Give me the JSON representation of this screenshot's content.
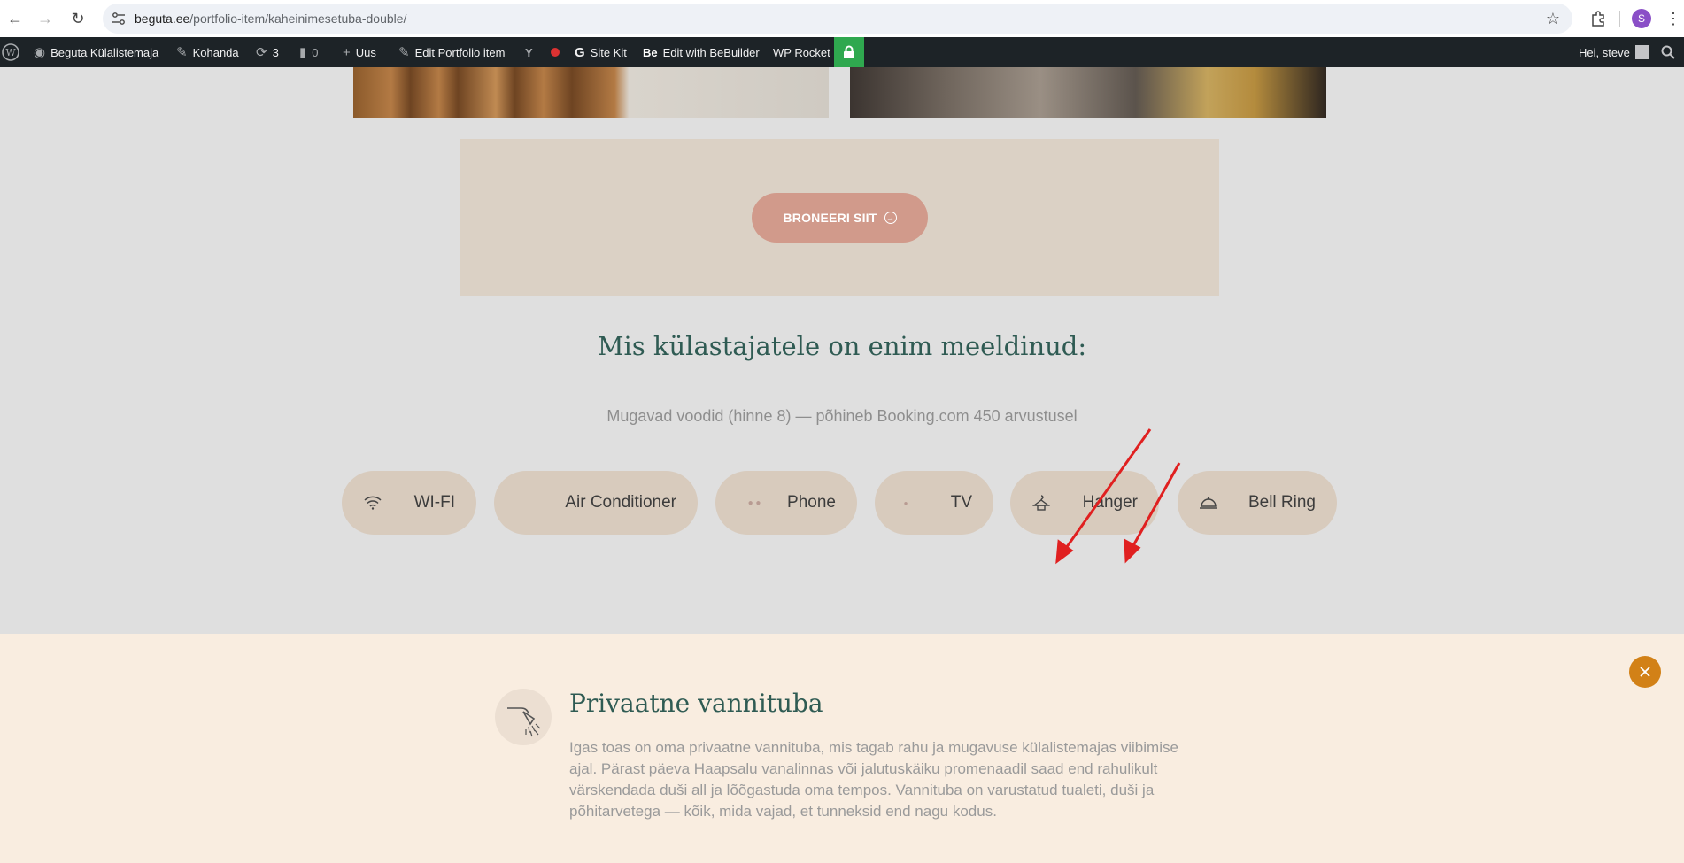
{
  "browser": {
    "url_host": "beguta.ee",
    "url_path": "/portfolio-item/kaheinimesetuba-double/",
    "profile_initial": "S"
  },
  "adminbar": {
    "site_name": "Beguta Külalistemaja",
    "customize": "Kohanda",
    "updates_count": "3",
    "comments_count": "0",
    "new": "Uus",
    "edit_item": "Edit Portfolio item",
    "site_kit": "Site Kit",
    "bebuilder": "Edit with BeBuilder",
    "wp_rocket": "WP Rocket",
    "greeting": "Hei, steve"
  },
  "booking": {
    "button_label": "BRONEERI SIIT"
  },
  "amenities": {
    "title": "Mis külastajatele on enim meeldinud:",
    "subtitle": "Mugavad voodid (hinne 8) — põhineb Booking.com 450 arvustusel",
    "items": [
      {
        "label": "WI-FI",
        "icon": "wifi-icon"
      },
      {
        "label": "Air Conditioner",
        "icon": "air-conditioner-icon"
      },
      {
        "label": "Phone",
        "icon": "phone-icon"
      },
      {
        "label": "TV",
        "icon": "tv-icon"
      },
      {
        "label": "Hanger",
        "icon": "hanger-icon"
      },
      {
        "label": "Bell Ring",
        "icon": "bell-ring-icon"
      }
    ]
  },
  "panel": {
    "title": "Privaatne vannituba",
    "text": "Igas toas on oma privaatne vannituba, mis tagab rahu ja mugavuse külalistemajas viibimise ajal. Pärast päeva Haapsalu vanalinnas või jalutuskäiku promenaadil saad end rahulikult värskendada duši all ja lõõgastuda oma tempos. Vannituba on varustatud tualeti, duši ja põhitarvetega — kõik, mida vajad, et tunneksid end nagu kodus."
  },
  "colors": {
    "accent_green": "#2f5b53",
    "button_salmon": "#d19a8b",
    "close_orange": "#d28117",
    "annotation_red": "#e02020"
  }
}
